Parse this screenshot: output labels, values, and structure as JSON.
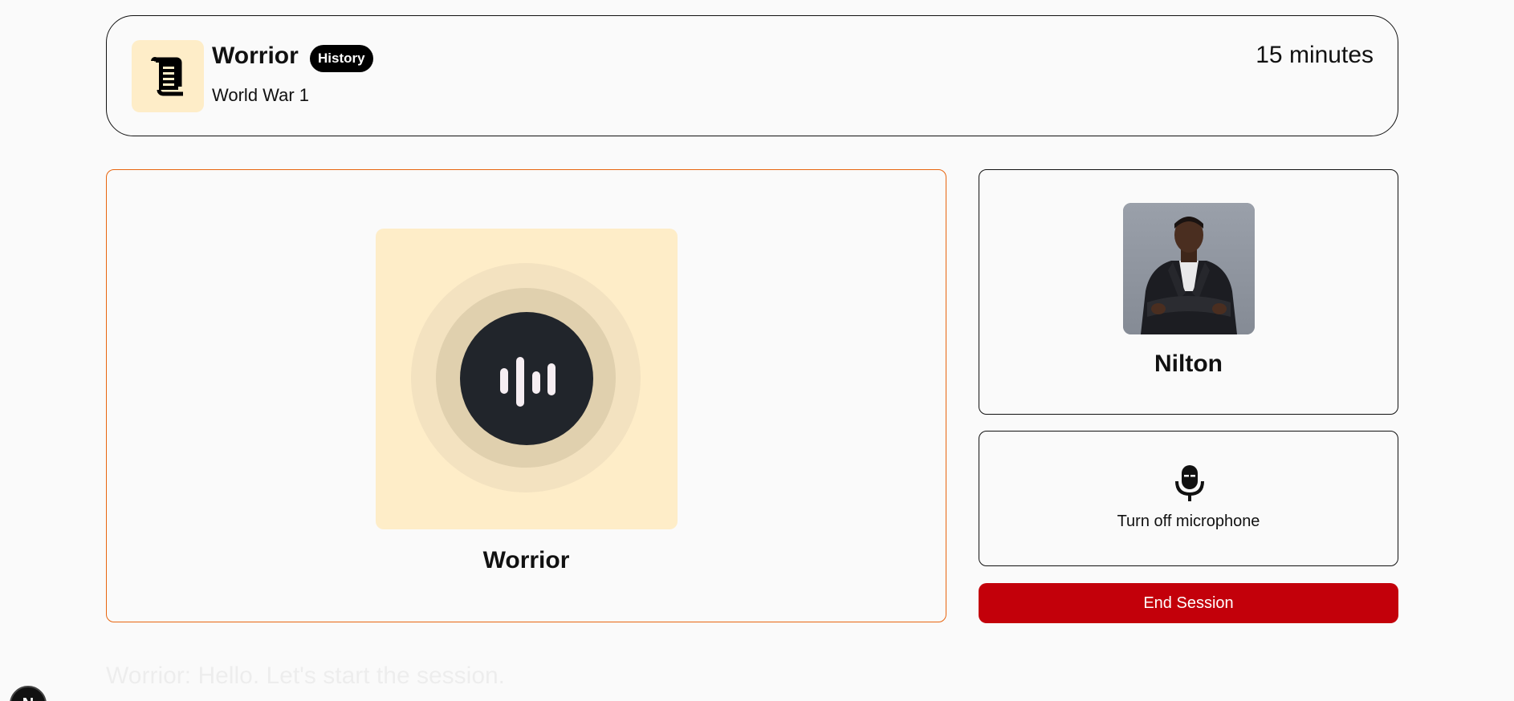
{
  "header": {
    "companion_name": "Worrior",
    "subject_badge": "History",
    "topic": "World War 1",
    "duration": "15 minutes",
    "subject_icon": "scroll-icon"
  },
  "companion": {
    "name": "Worrior",
    "icon": "soundwave-icon",
    "colors": {
      "card_border": "#e8650f",
      "avatar_bg": "#feedc8",
      "voice_circle": "#21252b"
    }
  },
  "user": {
    "name": "Nilton"
  },
  "controls": {
    "mic_label": "Turn off microphone",
    "mic_icon": "microphone-icon",
    "end_session_label": "End Session",
    "end_session_color": "#c3000a"
  },
  "transcript": {
    "line": "Worrior: Hello. Let's start the session."
  },
  "dev_badge": {
    "label": "N"
  }
}
